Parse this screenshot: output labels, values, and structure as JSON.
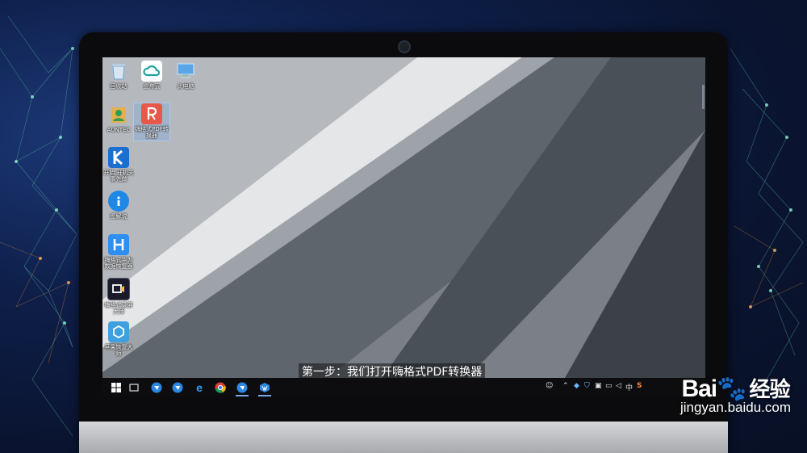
{
  "desktop": {
    "icons": [
      {
        "label": "回收站",
        "icon": "recycle-bin-icon",
        "color": "#6aa7d8"
      },
      {
        "label": "金舟云",
        "icon": "cloud-app-icon",
        "color": "#ffffff"
      },
      {
        "label": "此电脑",
        "icon": "this-pc-icon",
        "color": "#5aa5e6"
      },
      {
        "label": "AUNTEC",
        "icon": "user-folder-icon",
        "color": "#e3b04b"
      },
      {
        "label": "嗨格式PDF转换器",
        "icon": "pdf-converter-icon",
        "color": "#e8584a"
      },
      {
        "label": "开始 开机关 事先做",
        "icon": "k-app-icon",
        "color": "#1b6fd0"
      },
      {
        "label": "图解说",
        "icon": "info-app-icon",
        "color": "#1e88e5"
      },
      {
        "label": "嗨格式华为 数据恢复器",
        "icon": "h-app-icon",
        "color": "#2f8ff0"
      },
      {
        "label": "嗨格式录屏 大师",
        "icon": "screen-recorder-icon",
        "color": "#1a1a2a"
      },
      {
        "label": "苹果恢复大 师",
        "icon": "apple-recovery-icon",
        "color": "#3fa0e0"
      }
    ]
  },
  "subtitle": "第一步：我们打开嗨格式PDF转换器",
  "taskbar": {
    "items": [
      "windows-start-icon",
      "task-view-icon",
      "pinned-app-1-icon",
      "pinned-app-2-icon",
      "edge-icon",
      "chrome-icon",
      "pdf-app-taskbar-icon",
      "app-taskbar-icon"
    ],
    "tray_ime": "中",
    "tray_s": "S"
  },
  "watermark": {
    "brand": "Bai",
    "brand_tail": "经验",
    "url": "jingyan.baidu.com"
  }
}
